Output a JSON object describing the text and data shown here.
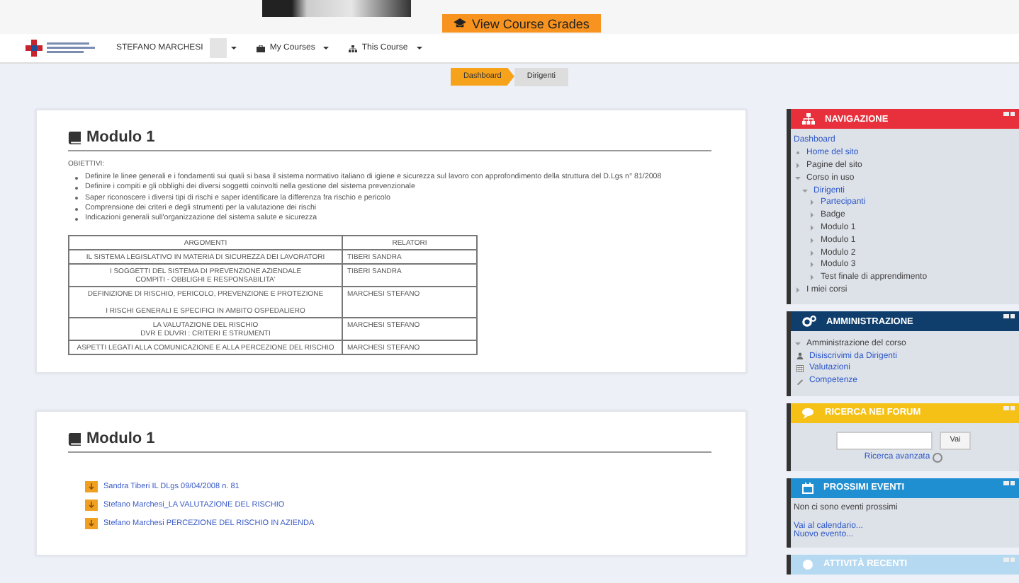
{
  "banner": {
    "button": "View Course Grades"
  },
  "header": {
    "user": "STEFANO MARCHESI",
    "menus": [
      "My Courses",
      "This Course"
    ]
  },
  "breadcrumb": [
    {
      "label": "Dashboard",
      "selected": false
    },
    {
      "label": "Dirigenti",
      "selected": true
    }
  ],
  "sections": [
    {
      "kind": "summary",
      "title": "Modulo 1",
      "heading": "OBIETTIVI:",
      "objectives": [
        "Definire le linee generali e i fondamenti sui quali si basa il sistema normativo italiano di igiene e sicurezza sul lavoro con approfondimento della struttura del D.Lgs n° 81/2008",
        "Definire i compiti e gli obblighi  dei diversi soggetti coinvolti nella gestione del sistema prevenzionale",
        "Saper riconoscere i diversi tipi di rischi e saper identificare la differenza fra rischio e pericolo",
        "Comprensione dei   criteri e degli strumenti per la valutazione dei rischi",
        "Indicazioni generali sull'organizzazione   del sistema salute e sicurezza"
      ],
      "table": {
        "columns": [
          "ARGOMENTI",
          "RELATORI"
        ],
        "rows": [
          [
            "IL SISTEMA LEGISLATIVO IN MATERIA DI SICUREZZA DEI LAVORATORI",
            "TIBERI SANDRA"
          ],
          [
            "I SOGGETTI DEL SISTEMA DI PREVENZIONE AZIENDALE\nCOMPITI - OBBLIGHI E RESPONSABILITA'",
            "TIBERI SANDRA"
          ],
          [
            "DEFINIZIONE DI RISCHIO, PERICOLO, PREVENZIONE E PROTEZIONE\n\nI RISCHI GENERALI E SPECIFICI IN AMBITO OSPEDALIERO",
            "MARCHESI STEFANO"
          ],
          [
            "LA VALUTAZIONE DEL RISCHIO\nDVR E DUVRI : CRITERI E STRUMENTI",
            "MARCHESI STEFANO"
          ],
          [
            "ASPETTI LEGATI ALLA COMUNICAZIONE E ALLA PERCEZIONE DEL RISCHIO",
            "MARCHESI STEFANO"
          ]
        ]
      }
    },
    {
      "kind": "files",
      "title": "Modulo 1",
      "files": [
        "Sandra Tiberi IL DLgs 09/04/2008 n. 81",
        "Stefano Marchesi_LA VALUTAZIONE DEL RISCHIO",
        "Stefano Marchesi PERCEZIONE DEL RISCHIO IN AZIENDA"
      ]
    }
  ],
  "blocks": [
    {
      "kind": "navigation",
      "title": "NAVIGAZIONE",
      "color": "#e8303c",
      "tree": [
        {
          "label": "Dashboard",
          "kind": "root",
          "link": true
        },
        {
          "label": "Home del sito",
          "kind": "leaf",
          "link": true
        },
        {
          "label": "Pagine del sito",
          "kind": "branch",
          "link": false,
          "expanded": false
        },
        {
          "label": "Corso in uso",
          "kind": "branch",
          "link": false,
          "expanded": true,
          "children": [
            {
              "label": "Dirigenti",
              "kind": "branch",
              "link": true,
              "expanded": true,
              "children": [
                {
                  "label": "Partecipanti",
                  "kind": "branch",
                  "link": true,
                  "expanded": false
                },
                {
                  "label": "Badge",
                  "kind": "branch",
                  "link": false,
                  "expanded": false
                },
                {
                  "label": "Modulo 1",
                  "kind": "branch",
                  "link": false,
                  "expanded": false
                },
                {
                  "label": "Modulo 1",
                  "kind": "branch",
                  "link": false,
                  "expanded": false
                },
                {
                  "label": "Modulo 2",
                  "kind": "branch",
                  "link": false,
                  "expanded": false
                },
                {
                  "label": "Modulo 3",
                  "kind": "branch",
                  "link": false,
                  "expanded": false
                },
                {
                  "label": "Test finale di apprendimento",
                  "kind": "branch",
                  "link": false,
                  "expanded": false
                }
              ]
            }
          ]
        },
        {
          "label": "I miei corsi",
          "kind": "branch",
          "link": false,
          "expanded": false
        }
      ]
    },
    {
      "kind": "administration",
      "title": "AMMINISTRAZIONE",
      "color": "#0f3e6c",
      "tree": [
        {
          "label": "Amministrazione del corso",
          "kind": "branch",
          "link": false,
          "expanded": true,
          "children": [
            {
              "label": "Disiscrivimi da Dirigenti",
              "kind": "tool",
              "link": true
            },
            {
              "label": "Valutazioni",
              "kind": "tool",
              "link": true
            },
            {
              "label": "Competenze",
              "kind": "tool",
              "link": true
            }
          ]
        }
      ]
    },
    {
      "kind": "search",
      "title": "RICERCA NEI FORUM",
      "color": "#f5c116",
      "button": "Vai",
      "link": "Ricerca avanzata"
    },
    {
      "kind": "events",
      "title": "PROSSIMI EVENTI",
      "color": "#1f8fd2",
      "text": "Non ci sono eventi prossimi",
      "links": [
        "Vai al calendario...",
        "Nuovo evento..."
      ]
    },
    {
      "kind": "recent",
      "title": "ATTIVITÀ RECENTI",
      "color": "#b5d9f0"
    }
  ]
}
